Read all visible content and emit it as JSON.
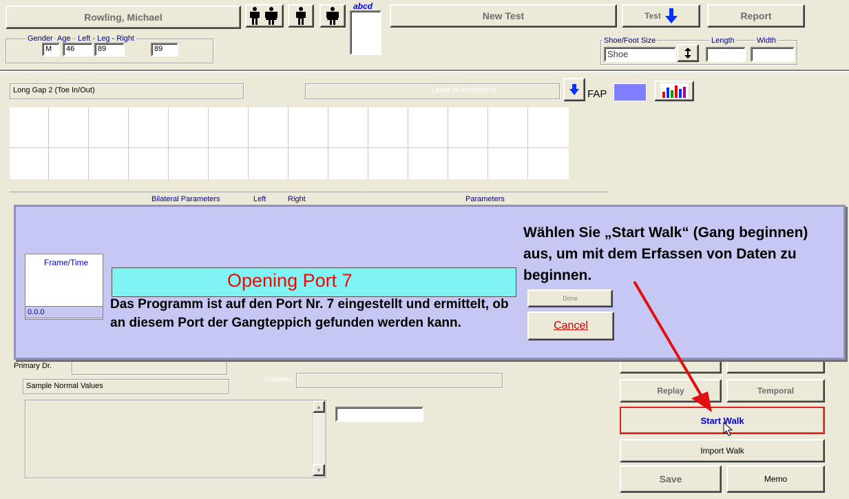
{
  "header": {
    "patient_name": "Rowling, Michael",
    "gender_label": "Gender",
    "age_label": "Age",
    "leg_label": "Left - Leg - Right",
    "gender_value": "M",
    "age_value": "46",
    "left_leg_value": "89",
    "right_leg_value": "89",
    "abcd_label": "abcd",
    "new_test_label": "New Test",
    "test_label": "Test",
    "report_label": "Report",
    "shoe_group_label": "Shoe/Foot Size",
    "shoe_value": "Shoe",
    "length_label": "Length",
    "width_label": "Width"
  },
  "main": {
    "test_name": "Long Gap 2 (Toe In/Out)",
    "assistance_label": "Level of Assistance",
    "fap_label": "FAP",
    "bilateral_header": "Bilateral Parameters",
    "left_col": "Left",
    "right_col": "Right",
    "parameters_header": "Parameters",
    "primary_dr_label": "Primary Dr.",
    "normals_value": "Sample Normal Values",
    "problem_label": "Problem"
  },
  "overlay": {
    "frame_time_label": "Frame/Time",
    "frame_time_value": "0.0.0",
    "status_text": "Opening Port 7",
    "note_port": "Das Programm ist auf den Port Nr. 7 eingestellt und ermittelt, ob an diesem Port der Gangteppich gefunden werden kann.",
    "note_start": "Wählen Sie „Start Walk“ (Gang beginnen) aus, um mit dem Erfassen von Daten zu beginnen.",
    "done_label": "Done",
    "cancel_label": "Cancel"
  },
  "buttons": {
    "replay": "Replay",
    "temporal": "Temporal",
    "start_walk": "Start Walk",
    "import_walk": "Import Walk",
    "save": "Save",
    "memo": "Memo"
  },
  "colors": {
    "overlay_bg": "#c7c7f4",
    "status_bg": "#80f4f4",
    "status_text": "#ff0000",
    "accent_blue": "#0000ff",
    "arrow_red": "#e01010",
    "highlight_border": "#e02020"
  }
}
